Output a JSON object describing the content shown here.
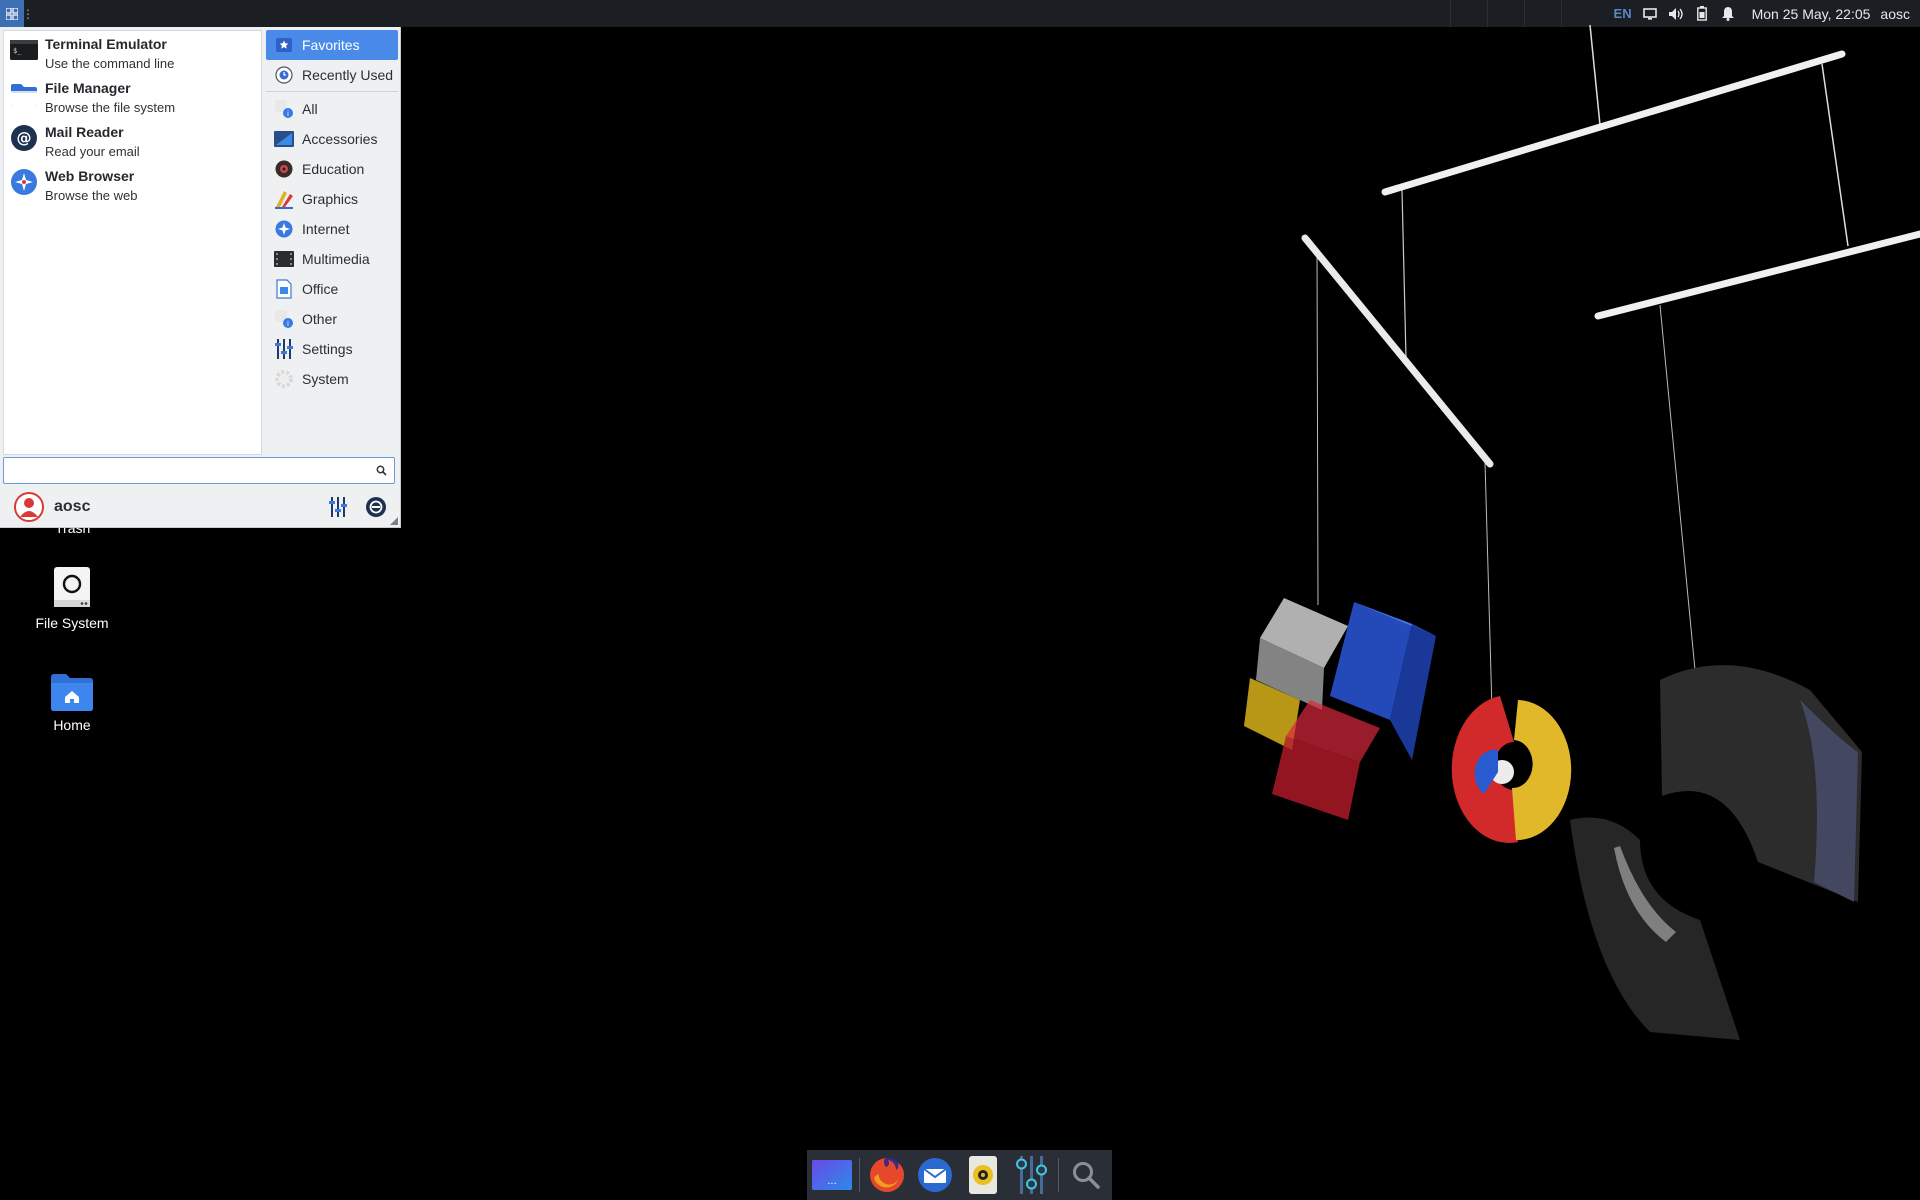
{
  "top_panel": {
    "keyboard_layout": "EN",
    "clock": "Mon 25 May, 22:05",
    "user": "aosc"
  },
  "whisker": {
    "favorites": [
      {
        "name": "Terminal Emulator",
        "desc": "Use the command line",
        "icon": "terminal-icon"
      },
      {
        "name": "File Manager",
        "desc": "Browse the file system",
        "icon": "folder-icon"
      },
      {
        "name": "Mail Reader",
        "desc": "Read your email",
        "icon": "mail-icon"
      },
      {
        "name": "Web Browser",
        "desc": "Browse the web",
        "icon": "web-icon"
      }
    ],
    "categories": [
      {
        "label": "Favorites",
        "active": true
      },
      {
        "label": "Recently Used"
      },
      {
        "label": "All"
      },
      {
        "label": "Accessories"
      },
      {
        "label": "Education"
      },
      {
        "label": "Graphics"
      },
      {
        "label": "Internet"
      },
      {
        "label": "Multimedia"
      },
      {
        "label": "Office"
      },
      {
        "label": "Other"
      },
      {
        "label": "Settings"
      },
      {
        "label": "System"
      }
    ],
    "search_placeholder": "",
    "username": "aosc"
  },
  "desktop": {
    "trash_label": "Trash",
    "file_system_label": "File System",
    "home_label": "Home"
  },
  "dock": {
    "items": [
      "show-desktop-icon",
      "firefox-icon",
      "mail-client-icon",
      "music-player-icon",
      "settings-manager-icon",
      "app-finder-icon"
    ]
  },
  "colors": {
    "panel": "#1b1f24",
    "accent": "#4a8ae8",
    "menu_bg": "#eef0f2",
    "desktop_bg": "#000000"
  }
}
